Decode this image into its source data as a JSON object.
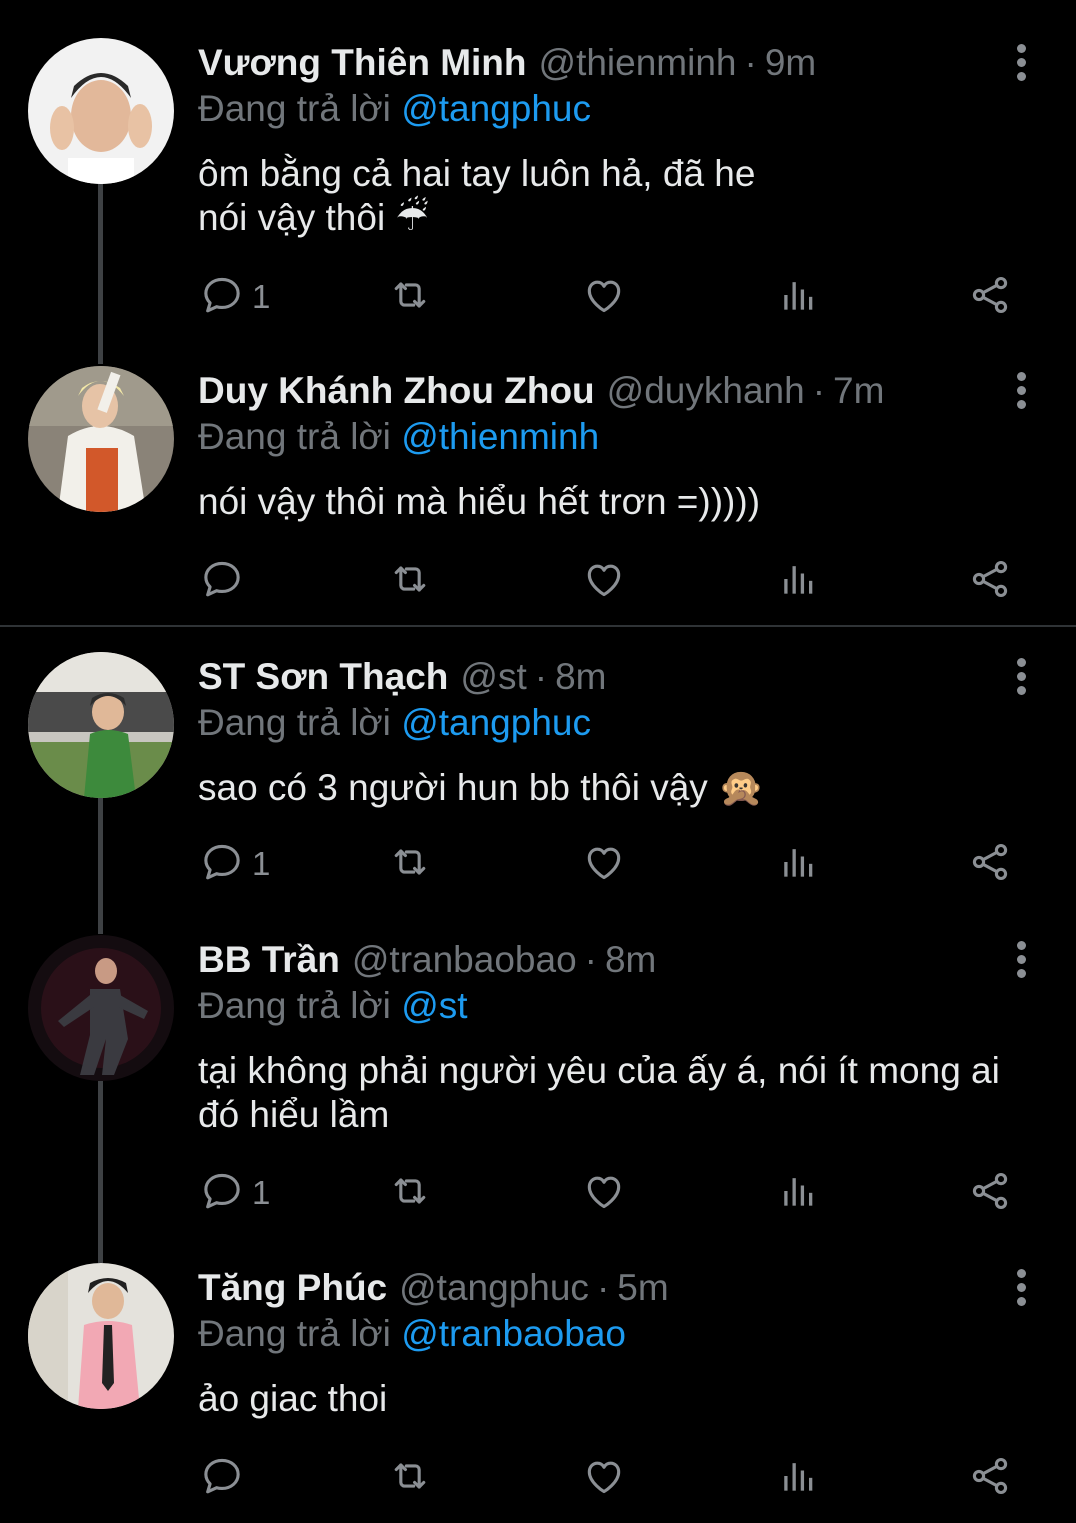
{
  "reply_prefix": "Đang trả lời",
  "colors": {
    "background": "#000000",
    "text": "#e7e9ea",
    "muted": "#71767b",
    "mention": "#1d9bf0",
    "icon": "#8b8f94",
    "line": "#3e4144"
  },
  "icons": [
    "reply-icon",
    "retweet-icon",
    "like-icon",
    "views-icon",
    "share-icon",
    "more-icon"
  ],
  "tweets": [
    {
      "name": "Vương Thiên Minh",
      "handle": "@thienminh",
      "time": "9m",
      "reply_to": "@tangphuc",
      "text_lines": [
        "ôm bằng cả hai tay luôn hả, đã he",
        "nói vậy thôi ☔"
      ],
      "reply_count": "1"
    },
    {
      "name": "Duy Khánh Zhou Zhou",
      "handle": "@duykhanh",
      "time": "7m",
      "reply_to": "@thienminh",
      "text_lines": [
        "nói vậy thôi mà hiểu hết trơn =)))))"
      ],
      "reply_count": ""
    },
    {
      "name": "ST Sơn Thạch",
      "handle": "@st",
      "time": "8m",
      "reply_to": "@tangphuc",
      "text_lines": [
        "sao có 3 người hun bb thôi vậy 🙊"
      ],
      "reply_count": "1"
    },
    {
      "name": "BB Trần",
      "handle": "@tranbaobao",
      "time": "8m",
      "reply_to": "@st",
      "text_lines": [
        "tại không phải người yêu của ấy á, nói ít mong ai",
        "đó hiểu lầm"
      ],
      "reply_count": "1"
    },
    {
      "name": "Tăng Phúc",
      "handle": "@tangphuc",
      "time": "5m",
      "reply_to": "@tranbaobao",
      "text_lines": [
        "ảo giac thoi"
      ],
      "reply_count": ""
    }
  ]
}
